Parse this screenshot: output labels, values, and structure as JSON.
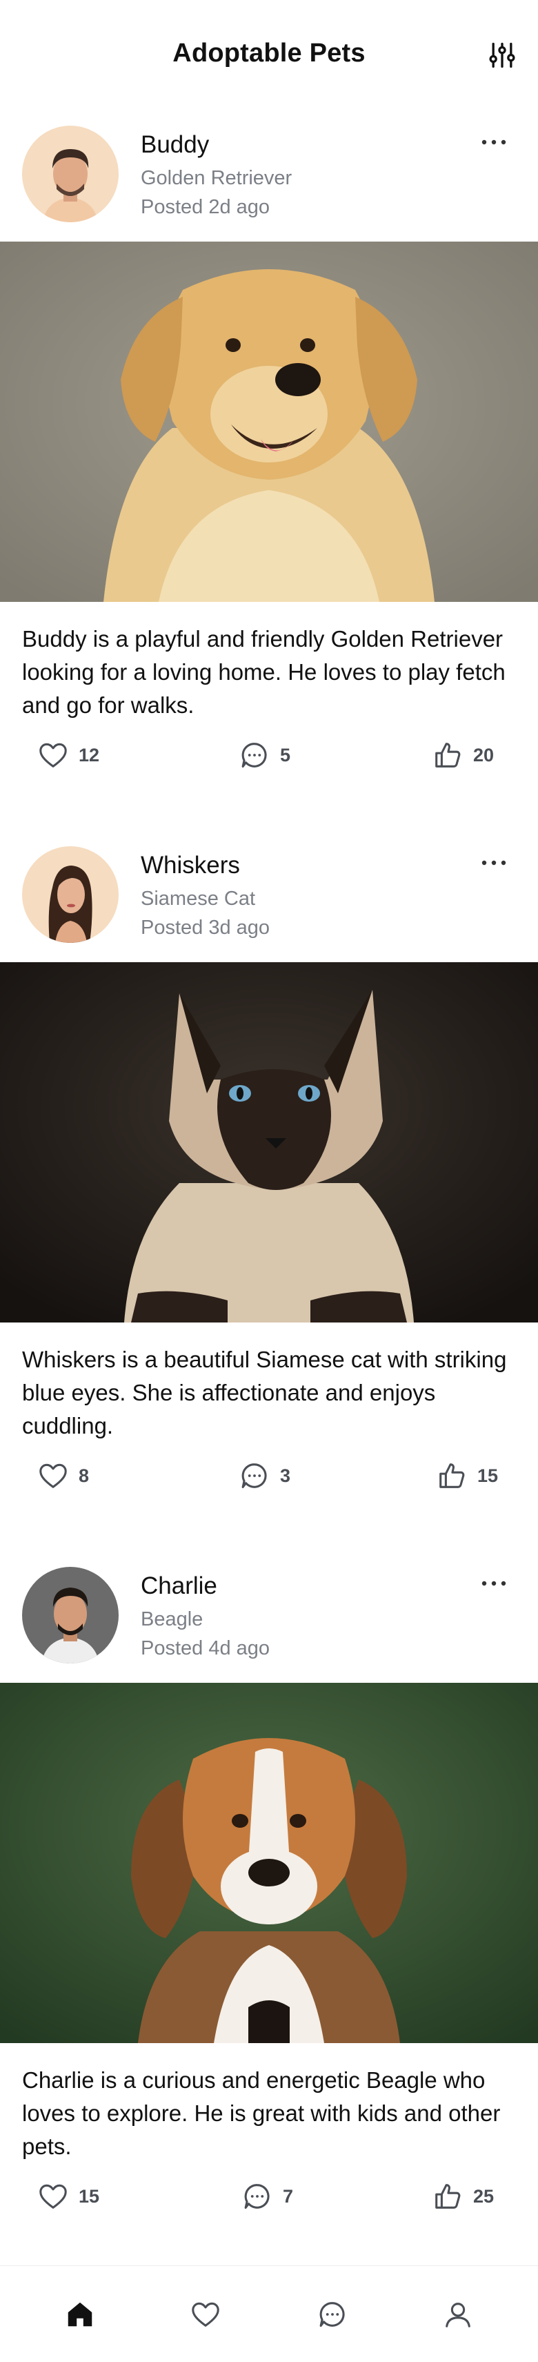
{
  "header": {
    "title": "Adoptable Pets",
    "filter_icon": "sliders-icon"
  },
  "posts": [
    {
      "name": "Buddy",
      "breed": "Golden Retriever",
      "posted": "Posted 2d ago",
      "description": "Buddy is a playful and friendly Golden Retriever looking for a loving home. He loves to play fetch and go for walks.",
      "likes": "12",
      "comments": "5",
      "thumbs": "20",
      "avatar_bg": "#f6dcc0",
      "photo_bg": "#8a8679"
    },
    {
      "name": "Whiskers",
      "breed": "Siamese Cat",
      "posted": "Posted 3d ago",
      "description": "Whiskers is a beautiful Siamese cat with striking blue eyes. She is affectionate and enjoys cuddling.",
      "likes": "8",
      "comments": "3",
      "thumbs": "15",
      "avatar_bg": "#f6dcc0",
      "photo_bg": "#1f1a16"
    },
    {
      "name": "Charlie",
      "breed": "Beagle",
      "posted": "Posted 4d ago",
      "description": "Charlie is a curious and energetic Beagle who loves to explore. He is great with kids and other pets.",
      "likes": "15",
      "comments": "7",
      "thumbs": "25",
      "avatar_bg": "#6b6b6b",
      "photo_bg": "#2e4a2c"
    }
  ],
  "tab_bar": {
    "items": [
      "home-icon",
      "heart-icon",
      "chat-icon",
      "profile-icon"
    ],
    "active": "home-icon"
  },
  "colors": {
    "text": "#111111",
    "muted": "#7b7f86",
    "icon": "#4a4e55"
  }
}
